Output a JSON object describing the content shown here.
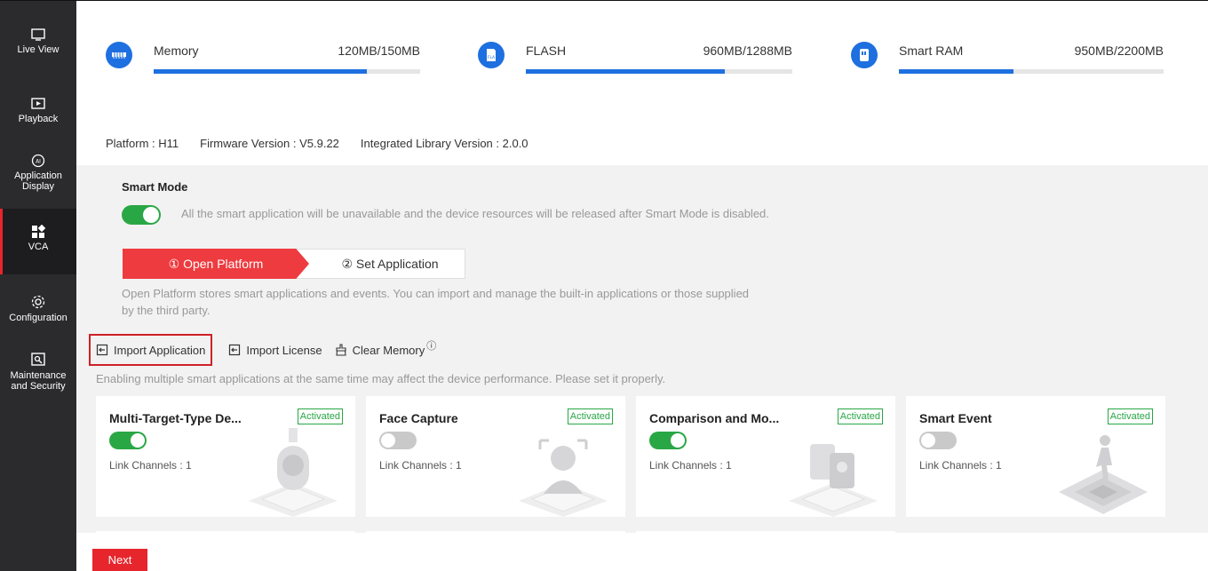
{
  "sidebar": {
    "items": [
      {
        "label": "Live View",
        "icon": "monitor-icon"
      },
      {
        "label": "Playback",
        "icon": "playback-icon"
      },
      {
        "label": "Application Display",
        "icon": "ai-icon"
      },
      {
        "label": "VCA",
        "icon": "vca-grid-icon",
        "active": true
      },
      {
        "label": "Configuration",
        "icon": "gear-icon"
      },
      {
        "label": "Maintenance and Security",
        "icon": "maintenance-icon"
      }
    ]
  },
  "resources": [
    {
      "name": "Memory",
      "value": "120MB/150MB",
      "used_fraction": 0.8
    },
    {
      "name": "FLASH",
      "value": "960MB/1288MB",
      "used_fraction": 0.745
    },
    {
      "name": "Smart RAM",
      "value": "950MB/2200MB",
      "used_fraction": 0.432
    }
  ],
  "platform": {
    "platform": "Platform : H11",
    "firmware": "Firmware Version : V5.9.22",
    "library": "Integrated Library Version : 2.0.0"
  },
  "smart_mode": {
    "title": "Smart Mode",
    "enabled": true,
    "description": "All the smart application will be unavailable and the device resources will be released after Smart Mode is disabled."
  },
  "steps": {
    "step1": "① Open Platform",
    "step2": "② Set Application"
  },
  "open_platform_desc": "Open Platform stores smart applications and events. You can import and manage the built-in applications or those supplied by the third party.",
  "actions": {
    "import_app": "Import Application",
    "import_license": "Import License",
    "clear_memory": "Clear Memory",
    "info": "ⓘ"
  },
  "multi_app_warning": "Enabling multiple smart applications at the same time may affect the device performance. Please set it properly.",
  "cards": [
    {
      "title": "Multi-Target-Type De...",
      "badge": "Activated",
      "enabled": true,
      "link": "Link Channels : 1"
    },
    {
      "title": "Face Capture",
      "badge": "Activated",
      "enabled": false,
      "link": "Link Channels : 1"
    },
    {
      "title": "Comparison and Mo...",
      "badge": "Activated",
      "enabled": true,
      "link": "Link Channels : 1"
    },
    {
      "title": "Smart Event",
      "badge": "Activated",
      "enabled": false,
      "link": "Link Channels : 1"
    }
  ],
  "next_label": "Next",
  "colors": {
    "accent": "#e7252c",
    "blue": "#1e6fe0",
    "green": "#2aa745",
    "sidebar": "#2b2b2d"
  }
}
